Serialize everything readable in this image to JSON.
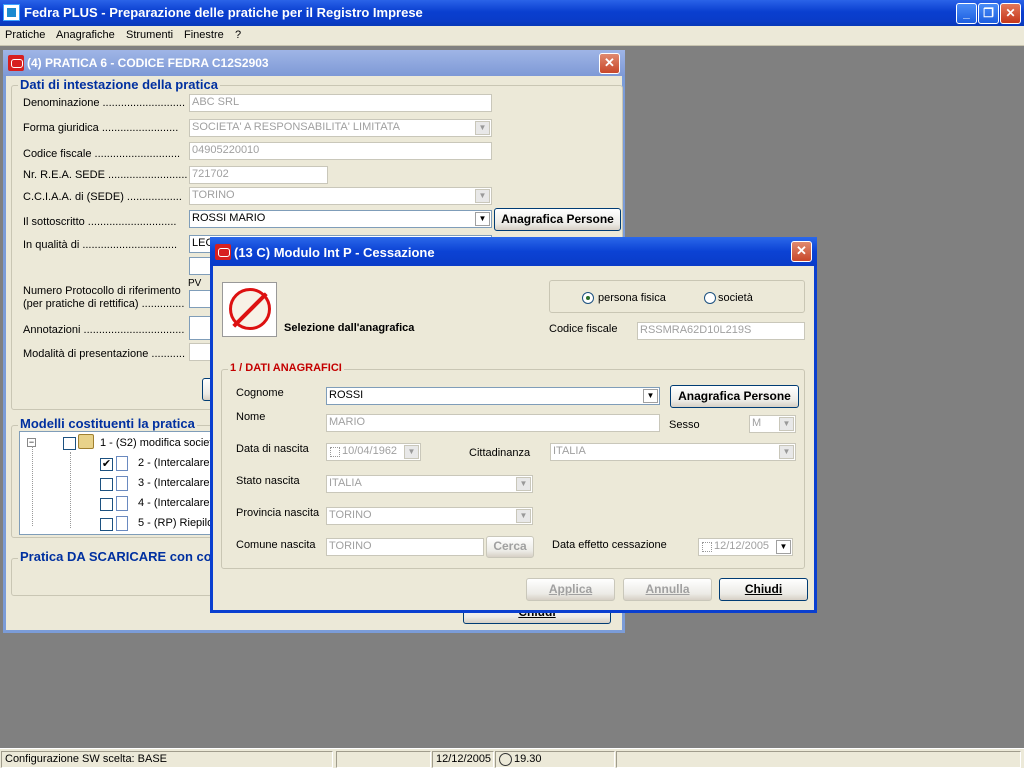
{
  "app": {
    "title": "Fedra PLUS  - Preparazione delle pratiche per il Registro Imprese",
    "menu": [
      "Pratiche",
      "Anagrafiche",
      "Strumenti",
      "Finestre",
      "?"
    ]
  },
  "back_window": {
    "title": "(4) PRATICA 6 - CODICE FEDRA C12S2903",
    "section_intestazione": "Dati di intestazione della pratica",
    "fields": {
      "denominazione_label": "Denominazione ...........................",
      "denominazione_value": "ABC SRL",
      "forma_label": "Forma giuridica .........................",
      "forma_value": "SOCIETA' A RESPONSABILITA' LIMITATA",
      "cf_label": "Codice fiscale ............................",
      "cf_value": "04905220010",
      "rea_label": "Nr. R.E.A. SEDE ..........................",
      "rea_value": "721702",
      "cciaa_label": "C.C.I.A.A. di (SEDE) ..................",
      "cciaa_value": "TORINO",
      "sottoscritto_label": "Il sottoscritto .............................",
      "sottoscritto_value": "ROSSI MARIO",
      "qualita_label": "In qualità di ...............................",
      "qualita_value": "LEGA",
      "protocollo_label_1": "Numero Protocollo di riferimento",
      "protocollo_label_2": "(per pratiche di rettifica) ..............",
      "pv_label": "PV",
      "annotazioni_label": "Annotazioni .................................",
      "modalita_label": "Modalità di presentazione ..........."
    },
    "anagrafica_btn": "Anagrafica Persone",
    "section_modelli": "Modelli costituenti la pratica",
    "tree": [
      {
        "label": "1 - (S2) modifica società"
      },
      {
        "label": "2 - (Intercalare I",
        "checked": true
      },
      {
        "label": "3 - (Intercalare I",
        "checked": false
      },
      {
        "label": "4 - (Intercalare I",
        "checked": false
      },
      {
        "label": "5 - (RP) Riepilog",
        "checked": false
      }
    ],
    "section_scaricare": "Pratica DA SCARICARE con co",
    "chiudi_btn": "Chiudi"
  },
  "dialog": {
    "title": "(13 C) Modulo Int P - Cessazione",
    "selezione_label": "Selezione dall'anagrafica",
    "radio_persona": "persona fisica",
    "radio_societa": "società",
    "radio_selected": "persona fisica",
    "codice_fiscale_label": "Codice fiscale",
    "codice_fiscale_value": "RSSMRA62D10L219S",
    "section_title": "1 / DATI ANAGRAFICI",
    "cognome_label": "Cognome",
    "cognome_value": "ROSSI",
    "anagrafica_btn": "Anagrafica Persone",
    "nome_label": "Nome",
    "nome_value": "MARIO",
    "sesso_label": "Sesso",
    "sesso_value": "M",
    "data_nascita_label": "Data di nascita",
    "data_nascita_value": "10/04/1962",
    "cittadinanza_label": "Cittadinanza",
    "cittadinanza_value": "ITALIA",
    "stato_nascita_label": "Stato nascita",
    "stato_nascita_value": "ITALIA",
    "provincia_nascita_label": "Provincia nascita",
    "provincia_nascita_value": "TORINO",
    "comune_nascita_label": "Comune nascita",
    "comune_nascita_value": "TORINO",
    "cerca_btn": "Cerca",
    "data_effetto_label": "Data effetto cessazione",
    "data_effetto_value": "12/12/2005",
    "applica_btn": "Applica",
    "annulla_btn": "Annulla",
    "chiudi_btn": "Chiudi"
  },
  "status": {
    "config": "Configurazione SW scelta: BASE",
    "date": "12/12/2005",
    "time": "19.30"
  }
}
